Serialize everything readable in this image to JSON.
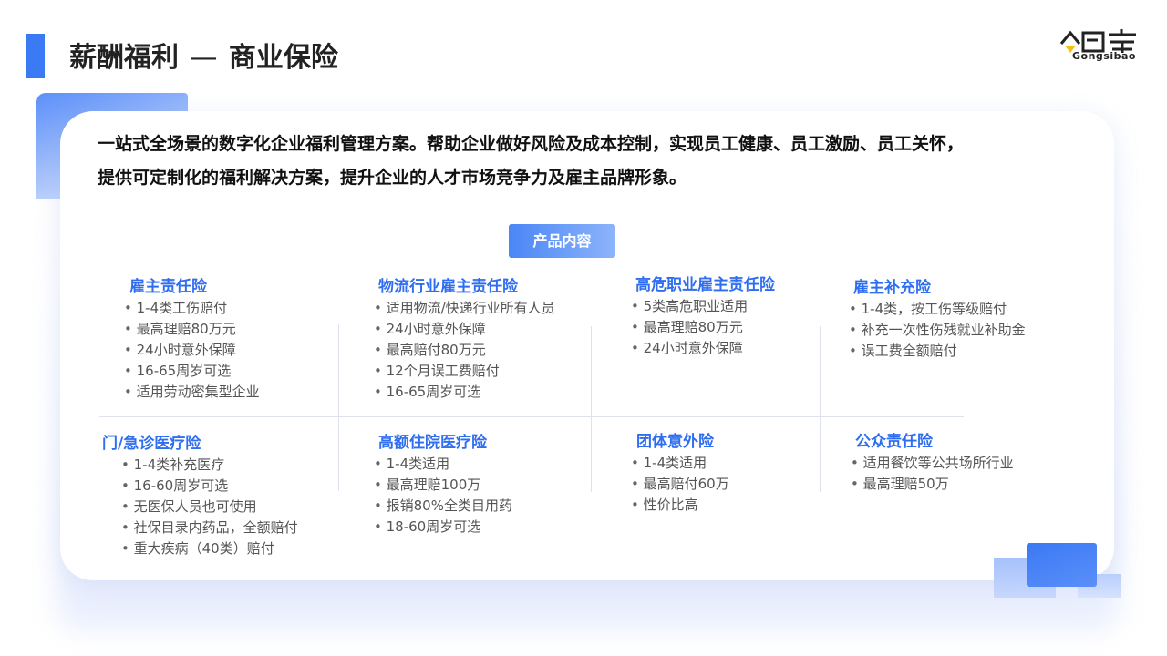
{
  "header": {
    "title_main": "薪酬福利",
    "title_dash": "—",
    "title_sub": "商业保险"
  },
  "logo": {
    "name": "公司宝",
    "latin": "Gongsibao"
  },
  "intro": {
    "line1": "一站式全场景的数字化企业福利管理方案。帮助企业做好风险及成本控制，实现员工健康、员工激励、员工关怀，",
    "line2": "提供可定制化的福利解决方案，提升企业的人才市场竞争力及雇主品牌形象。"
  },
  "badge": "产品内容",
  "categories": [
    {
      "title": "雇主责任险",
      "items": [
        "1-4类工伤赔付",
        "最高理赔80万元",
        "24小时意外保障",
        "16-65周岁可选",
        "适用劳动密集型企业"
      ]
    },
    {
      "title": "物流行业雇主责任险",
      "items": [
        "适用物流/快递行业所有人员",
        "24小时意外保障",
        "最高赔付80万元",
        "12个月误工费赔付",
        "16-65周岁可选"
      ]
    },
    {
      "title": "高危职业雇主责任险",
      "items": [
        "5类高危职业适用",
        "最高理赔80万元",
        "24小时意外保障"
      ]
    },
    {
      "title": "雇主补充险",
      "items": [
        "1-4类，按工伤等级赔付",
        "补充一次性伤残就业补助金",
        "误工费全额赔付"
      ]
    },
    {
      "title": "门/急诊医疗险",
      "items": [
        "1-4类补充医疗",
        "16-60周岁可选",
        "无医保人员也可使用",
        "社保目录内药品，全额赔付",
        "重大疾病（40类）赔付"
      ]
    },
    {
      "title": "高额住院医疗险",
      "items": [
        "1-4类适用",
        "最高理赔100万",
        "报销80%全类目用药",
        "18-60周岁可选"
      ]
    },
    {
      "title": "团体意外险",
      "items": [
        "1-4类适用",
        "最高赔付60万",
        "性价比高"
      ]
    },
    {
      "title": "公众责任险",
      "items": [
        "适用餐饮等公共场所行业",
        "最高理赔50万"
      ]
    }
  ],
  "colors": {
    "accent": "#3a7bf5",
    "category_title": "#2f6ef0"
  }
}
